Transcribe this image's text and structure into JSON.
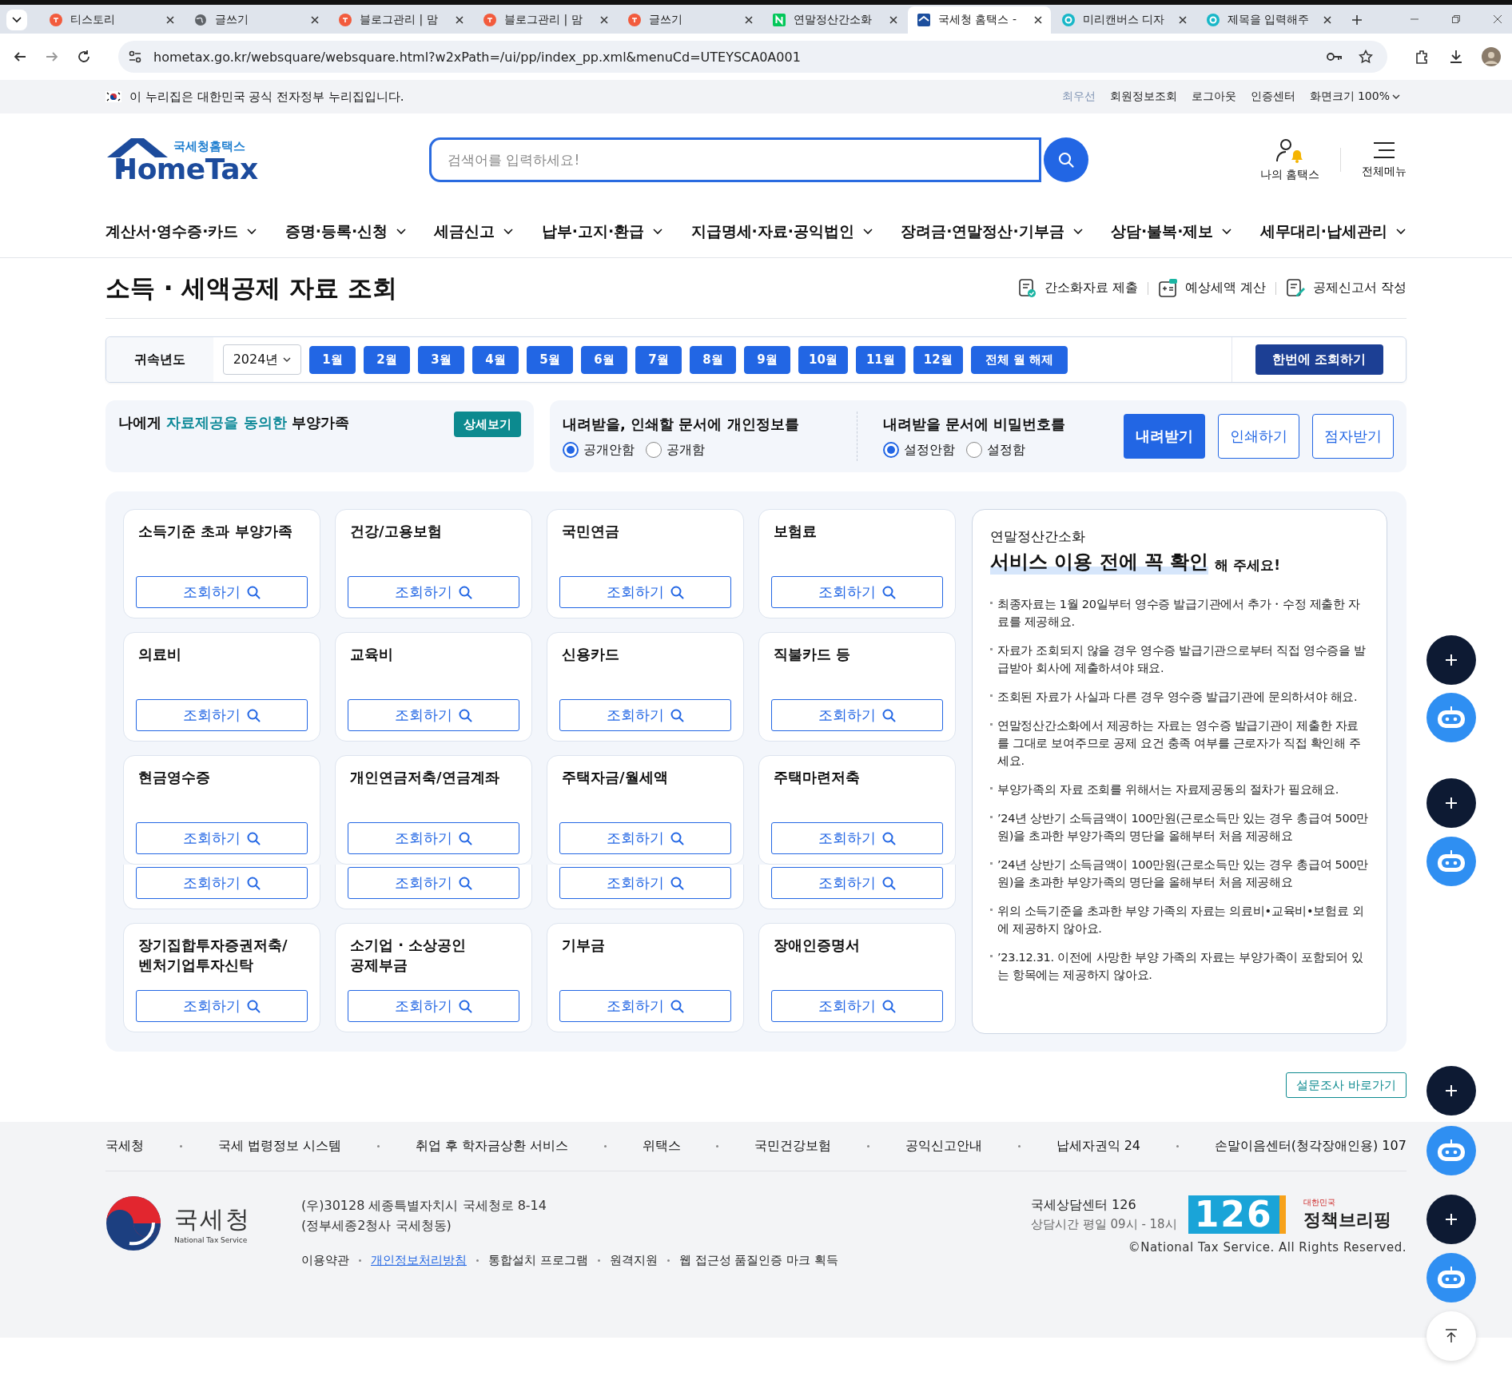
{
  "browser": {
    "tabs": [
      {
        "title": "티스토리",
        "kind": "dot",
        "selected": false
      },
      {
        "title": "글쓰기",
        "kind": "globe",
        "selected": false
      },
      {
        "title": "블로그관리 | 맘",
        "kind": "dot",
        "selected": false
      },
      {
        "title": "블로그관리 | 맘",
        "kind": "dot",
        "selected": false
      },
      {
        "title": "글쓰기",
        "kind": "dot",
        "selected": false
      },
      {
        "title": "연말정산간소화",
        "kind": "square",
        "selected": false
      },
      {
        "title": "국세청 홈택스 -",
        "kind": "house",
        "selected": true
      },
      {
        "title": "미리캔버스 디자",
        "kind": "ring",
        "selected": false
      },
      {
        "title": "제목을 입력해주",
        "kind": "ring",
        "selected": false
      }
    ],
    "url": "hometax.go.kr/websquare/websquare.html?w2xPath=/ui/pp/index_pp.xml&menuCd=UTEYSCA0A001"
  },
  "gov_banner": {
    "text": "이 누리집은 대한민국 공식 전자정부 누리집입니다.",
    "links": [
      {
        "label": "최우선",
        "dimmed": true
      },
      {
        "label": "회원정보조회",
        "dimmed": false
      },
      {
        "label": "로그아웃",
        "dimmed": false
      },
      {
        "label": "인증센터",
        "dimmed": false
      },
      {
        "label": "화면크기 100%",
        "dimmed": false
      }
    ]
  },
  "header": {
    "logo_caption": "국세청홈택스",
    "logo": "HomeTax",
    "search": {
      "placeholder": "검색어를 입력하세요!"
    },
    "my_hometax": "나의 홈택스",
    "all_menu": "전체메뉴"
  },
  "nav": [
    "계산서·영수증·카드",
    "증명·등록·신청",
    "세금신고",
    "납부·고지·환급",
    "지급명세·자료·공익법인",
    "장려금·연말정산·기부금",
    "상담·불복·제보",
    "세무대리·납세관리"
  ],
  "page": {
    "title": "소득 · 세액공제 자료 조회",
    "quick_links": [
      "간소화자료 제출",
      "예상세액 계산",
      "공제신고서 작성"
    ]
  },
  "filter": {
    "label": "귀속년도",
    "year": "2024년",
    "months": [
      {
        "label": "1월",
        "selected": true
      },
      {
        "label": "2월",
        "selected": true
      },
      {
        "label": "3월",
        "selected": true
      },
      {
        "label": "4월",
        "selected": true
      },
      {
        "label": "5월",
        "selected": true
      },
      {
        "label": "6월",
        "selected": true
      },
      {
        "label": "7월",
        "selected": true
      },
      {
        "label": "8월",
        "selected": true
      },
      {
        "label": "9월",
        "selected": true
      },
      {
        "label": "10월",
        "selected": true
      },
      {
        "label": "11월",
        "selected": true
      },
      {
        "label": "12월",
        "selected": true
      }
    ],
    "clear": "전체 월 해제",
    "submit": "한번에 조회하기"
  },
  "dependents": {
    "text": "나에게 **자료제공을 동의한** 부양가족",
    "button": "상세보기"
  },
  "privacy": {
    "title": "내려받을, 인쇄할 문서에 개인정보를",
    "options": [
      {
        "label": "공개안함",
        "selected": true
      },
      {
        "label": "공개함",
        "selected": false
      }
    ]
  },
  "password": {
    "title": "내려받을 문서에 비밀번호를",
    "options": [
      {
        "label": "설정안함",
        "selected": true
      },
      {
        "label": "설정함",
        "selected": false
      }
    ]
  },
  "actions": [
    {
      "label": "내려받기",
      "kind": "primary"
    },
    {
      "label": "인쇄하기",
      "kind": "outline"
    },
    {
      "label": "점자받기",
      "kind": "outline"
    }
  ],
  "cards": [
    {
      "kind": "full",
      "title": "소득기준 초과 부양가족",
      "button": "조회하기"
    },
    {
      "kind": "full",
      "title": "건강/고용보험",
      "button": "조회하기"
    },
    {
      "kind": "full",
      "title": "국민연금",
      "button": "조회하기"
    },
    {
      "kind": "full",
      "title": "보험료",
      "button": "조회하기"
    },
    {
      "kind": "full",
      "title": "의료비",
      "button": "조회하기"
    },
    {
      "kind": "full",
      "title": "교육비",
      "button": "조회하기"
    },
    {
      "kind": "full",
      "title": "신용카드",
      "button": "조회하기"
    },
    {
      "kind": "full",
      "title": "직불카드 등",
      "button": "조회하기"
    },
    {
      "kind": "full",
      "title": "현금영수증",
      "button": "조회하기"
    },
    {
      "kind": "full",
      "title": "개인연금저축/연금계좌",
      "button": "조회하기"
    },
    {
      "kind": "full",
      "title": "주택자금/월세액",
      "button": "조회하기"
    },
    {
      "kind": "full",
      "title": "주택마련저축",
      "button": "조회하기"
    },
    {
      "kind": "clipped",
      "button": "조회하기"
    },
    {
      "kind": "clipped",
      "button": "조회하기"
    },
    {
      "kind": "clipped",
      "button": "조회하기"
    },
    {
      "kind": "clipped",
      "button": "조회하기"
    },
    {
      "kind": "full",
      "title": "장기집합투자증권저축/\n벤처기업투자신탁",
      "button": "조회하기"
    },
    {
      "kind": "full",
      "title": "소기업 · 소상공인\n공제부금",
      "button": "조회하기"
    },
    {
      "kind": "full",
      "title": "기부금",
      "button": "조회하기"
    },
    {
      "kind": "full",
      "title": "장애인증명서",
      "button": "조회하기"
    }
  ],
  "notice": {
    "eyebrow": "연말정산간소화",
    "heading": "서비스 이용 전에 꼭 확인",
    "heading_suffix": "해 주세요!",
    "bullets": [
      "최종자료는 1월 20일부터 영수증 발급기관에서 추가・수정 제출한 자료를 제공해요.",
      "자료가 조회되지 않을 경우 영수증 발급기관으로부터 직접 영수증을 발급받아 회사에 제출하셔야 돼요.",
      "조회된 자료가 사실과 다른 경우 영수증 발급기관에 문의하셔야 해요.",
      "연말정산간소화에서 제공하는 자료는 영수증 발급기관이 제출한 자료를 그대로 보여주므로 공제 요건 충족 여부를 근로자가 직접 확인해 주세요.",
      "부양가족의 자료 조회를 위해서는 자료제공동의 절차가 필요해요.",
      "’24년 상반기 소득금액이 100만원(근로소득만 있는 경우 총급여 500만원)을 초과한 부양가족의 명단을 올해부터 처음 제공해요",
      "’24년 상반기 소득금액이 100만원(근로소득만 있는 경우 총급여 500만원)을 초과한 부양가족의 명단을 올해부터 처음 제공해요",
      "위의 소득기준을 초과한 부양 가족의 자료는 의료비•교육비•보험료 외에 제공하지 않아요.",
      "’23.12.31. 이전에 사망한 부양 가족의 자료는 부양가족이 포함되어 있는 항목에는 제공하지 않아요."
    ]
  },
  "survey_button": "설문조사 바로가기",
  "footer": {
    "links": [
      "국세청",
      "국세 법령정보 시스템",
      "취업 후 학자금상환 서비스",
      "위택스",
      "국민건강보험",
      "공익신고안내",
      "납세자권익 24",
      "손말이음센터(청각장애인용) 107"
    ],
    "org": "국세청",
    "org_en": "National Tax Service",
    "address": [
      "(우)30128 세종특별자치시 국세청로 8-14",
      "(정부세종2청사 국세청동)"
    ],
    "policies": [
      {
        "label": "이용약관",
        "kind": "plain"
      },
      {
        "label": "개인정보처리방침",
        "kind": "highlight"
      },
      {
        "label": "통합설치 프로그램",
        "kind": "plain"
      },
      {
        "label": "원격지원",
        "kind": "plain"
      },
      {
        "label": "웹 접근성 품질인증 마크 획득",
        "kind": "plain"
      }
    ],
    "center": "국세상담센터 126",
    "hours": "상담시간 평일 09시 - 18시",
    "center_logo": "126",
    "briefing_caption": "대한민국",
    "briefing": "정책브리핑",
    "copyright": "©National Tax Service. All Rights Reserved."
  },
  "floating_buttons": [
    {
      "kind": "add"
    },
    {
      "kind": "bot"
    },
    {
      "kind": "add"
    },
    {
      "kind": "bot"
    },
    {
      "kind": "add"
    },
    {
      "kind": "bot"
    },
    {
      "kind": "add"
    },
    {
      "kind": "bot"
    },
    {
      "kind": "top"
    }
  ]
}
